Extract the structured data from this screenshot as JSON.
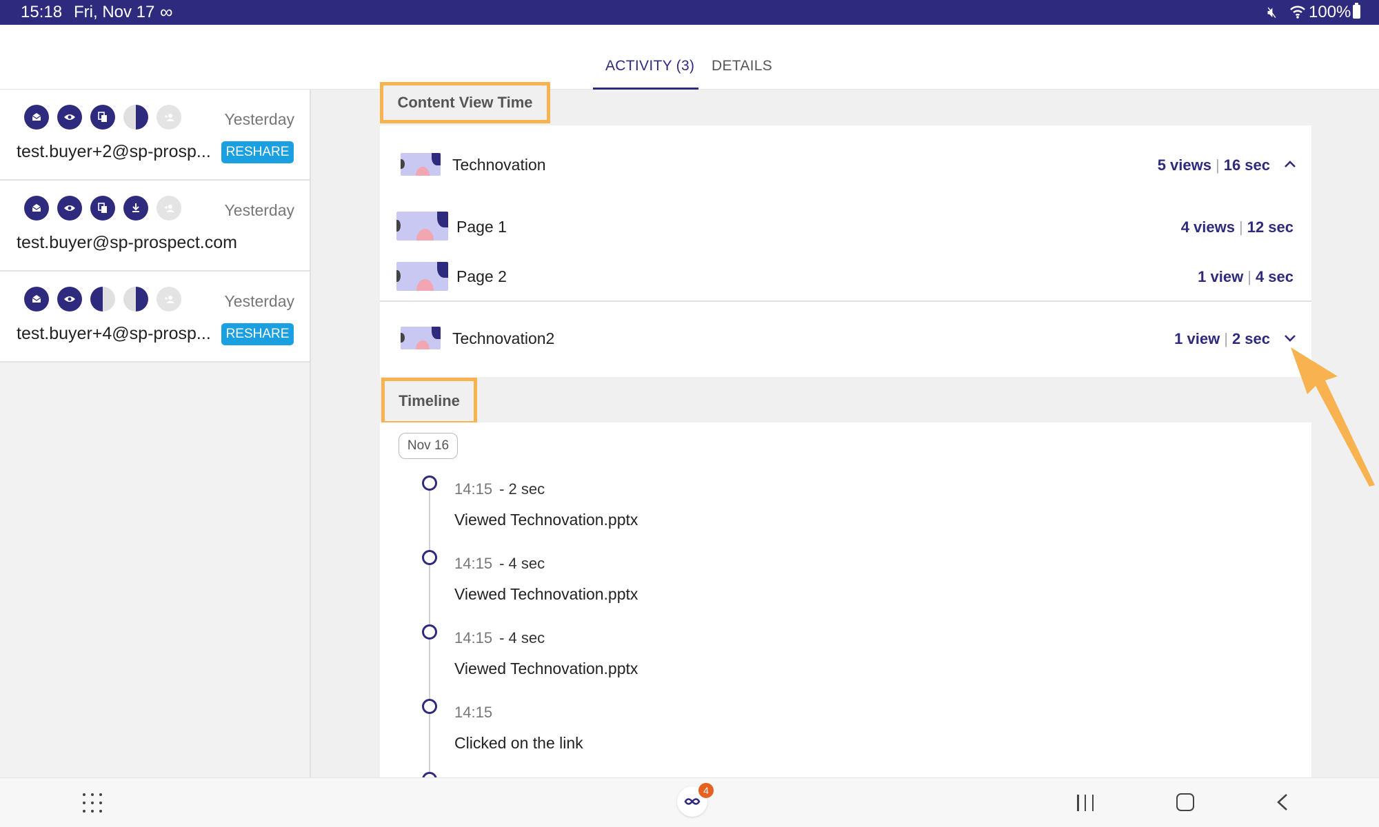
{
  "status_bar": {
    "time": "15:18",
    "date": "Fri, Nov 17",
    "battery": "100%"
  },
  "tabs": [
    {
      "label": "ACTIVITY (3)",
      "active": true
    },
    {
      "label": "DETAILS",
      "active": false
    }
  ],
  "contacts": [
    {
      "email": "test.buyer+2@sp-prosp...",
      "when": "Yesterday",
      "action": "RESHARE",
      "icons": [
        "email-icon",
        "eye-icon",
        "copy-icon",
        "half-circle-icon",
        "person-add-icon"
      ]
    },
    {
      "email": "test.buyer@sp-prospect.com",
      "when": "Yesterday",
      "action": "",
      "icons": [
        "email-icon",
        "eye-icon",
        "copy-icon",
        "download-icon",
        "person-add-icon"
      ]
    },
    {
      "email": "test.buyer+4@sp-prosp...",
      "when": "Yesterday",
      "action": "RESHARE",
      "icons": [
        "email-icon",
        "eye-icon",
        "half-circle-icon",
        "half-circle-icon",
        "person-add-icon"
      ]
    }
  ],
  "content_view_time": {
    "heading": "Content View Time",
    "items": [
      {
        "title": "Technovation",
        "views": "5 views",
        "time": "16 sec",
        "expanded": true,
        "pages": [
          {
            "title": "Page 1",
            "views": "4 views",
            "time": "12 sec"
          },
          {
            "title": "Page 2",
            "views": "1 view",
            "time": "4 sec"
          }
        ]
      },
      {
        "title": "Technovation2",
        "views": "1 view",
        "time": "2 sec",
        "expanded": false
      }
    ]
  },
  "timeline": {
    "heading": "Timeline",
    "date": "Nov 16",
    "events": [
      {
        "time": "14:15",
        "duration": "- 2 sec",
        "text": "Viewed Technovation.pptx"
      },
      {
        "time": "14:15",
        "duration": "- 4 sec",
        "text": "Viewed Technovation.pptx"
      },
      {
        "time": "14:15",
        "duration": "- 4 sec",
        "text": "Viewed Technovation.pptx"
      },
      {
        "time": "14:15",
        "duration": "",
        "text": "Clicked on the link"
      }
    ]
  },
  "nav": {
    "badge": "4"
  },
  "colors": {
    "brand": "#2e2a7e",
    "reshare": "#1a9fe0",
    "highlight": "#f8b24f",
    "badge": "#e8601f"
  }
}
